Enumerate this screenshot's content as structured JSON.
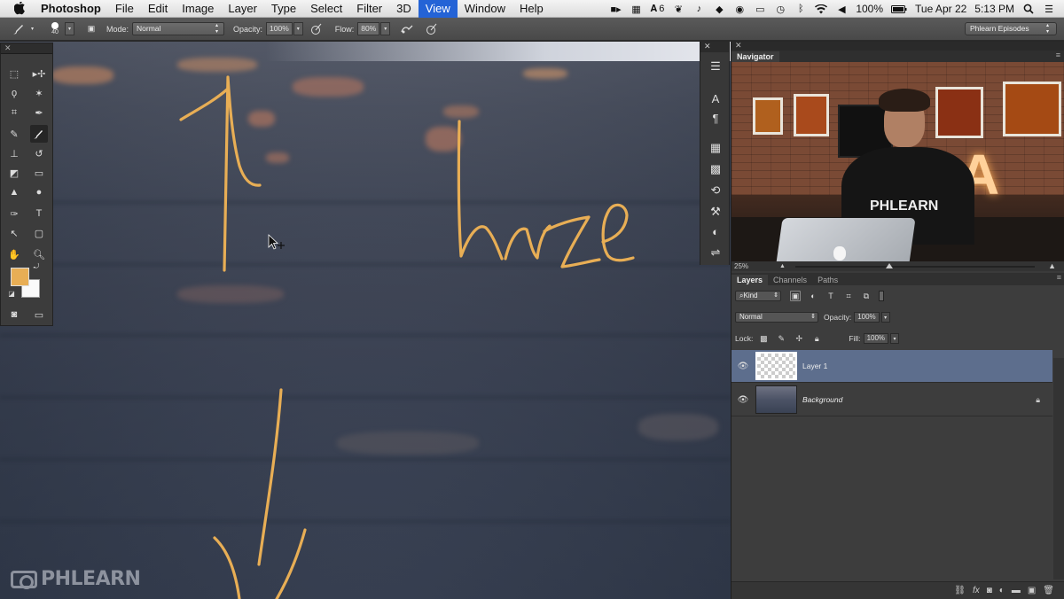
{
  "menubar": {
    "app_name": "Photoshop",
    "items": [
      "File",
      "Edit",
      "Image",
      "Layer",
      "Type",
      "Select",
      "Filter",
      "3D",
      "View",
      "Window",
      "Help"
    ],
    "active_item": "View",
    "tray": {
      "adobe_count": "6",
      "battery": "100%",
      "date": "Tue Apr 22",
      "time": "5:13 PM"
    }
  },
  "options": {
    "brush_size": "40",
    "mode_label": "Mode:",
    "mode_value": "Normal",
    "opacity_label": "Opacity:",
    "opacity_value": "100%",
    "flow_label": "Flow:",
    "flow_value": "80%",
    "workspace": "Phlearn Episodes"
  },
  "canvas": {
    "annotation_text": "haze",
    "brush_color": "#e8ae55",
    "watermark": "PHLEARN"
  },
  "tools": {
    "foreground_color": "#e8ae55",
    "background_color": "#fafafa"
  },
  "navigator": {
    "tab": "Navigator",
    "zoom": "25%",
    "preview_shirt_text": "PHLEARN",
    "preview_sign_letter": "A"
  },
  "layers": {
    "tabs": [
      "Layers",
      "Channels",
      "Paths"
    ],
    "filter_kind": "Kind",
    "blend_mode": "Normal",
    "opacity_label": "Opacity:",
    "opacity_value": "100%",
    "lock_label": "Lock:",
    "fill_label": "Fill:",
    "fill_value": "100%",
    "items": [
      {
        "name": "Layer 1",
        "selected": true,
        "visible": true,
        "locked": false
      },
      {
        "name": "Background",
        "selected": false,
        "visible": true,
        "locked": true
      }
    ]
  }
}
